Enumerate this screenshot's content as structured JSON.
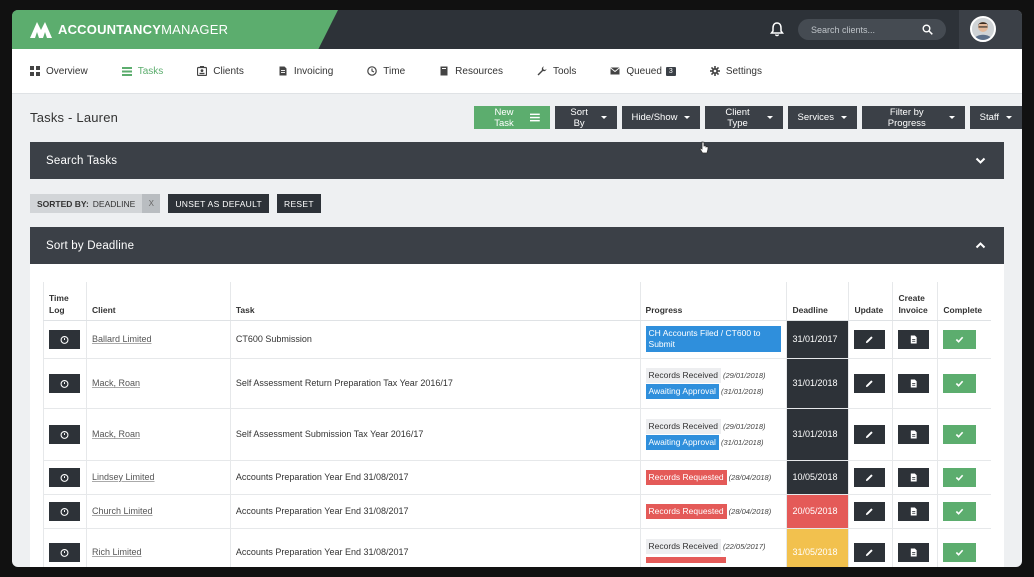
{
  "brand": {
    "name_bold": "ACCOUNTANCY",
    "name_rest": "MANAGER"
  },
  "search": {
    "placeholder": "Search clients..."
  },
  "nav": [
    {
      "label": "Overview",
      "icon": "grid-icon"
    },
    {
      "label": "Tasks",
      "icon": "list-icon",
      "active": true
    },
    {
      "label": "Clients",
      "icon": "contact-card-icon"
    },
    {
      "label": "Invoicing",
      "icon": "document-icon"
    },
    {
      "label": "Time",
      "icon": "clock-icon"
    },
    {
      "label": "Resources",
      "icon": "book-icon"
    },
    {
      "label": "Tools",
      "icon": "wrench-icon"
    },
    {
      "label": "Queued",
      "icon": "envelope-icon",
      "badge": "3"
    },
    {
      "label": "Settings",
      "icon": "gear-icon"
    }
  ],
  "page": {
    "title": "Tasks - Lauren"
  },
  "toolbar": {
    "new_task": "New Task",
    "dropdowns": [
      "Sort By",
      "Hide/Show",
      "Client Type",
      "Services",
      "Filter by Progress",
      "Staff"
    ]
  },
  "search_panel": {
    "title": "Search Tasks"
  },
  "sortbar": {
    "label": "SORTED BY:",
    "value": "DEADLINE",
    "remove": "X",
    "unset": "UNSET AS DEFAULT",
    "reset": "RESET"
  },
  "deadline_panel": {
    "title": "Sort by Deadline"
  },
  "table": {
    "headers": {
      "timelog_1": "Time",
      "timelog_2": "Log",
      "client": "Client",
      "task": "Task",
      "progress": "Progress",
      "deadline": "Deadline",
      "update": "Update",
      "invoice_1": "Create",
      "invoice_2": "Invoice",
      "complete": "Complete"
    },
    "rows": [
      {
        "client": "Ballard Limited",
        "task": "CT600 Submission",
        "progress": [
          {
            "text": "CH Accounts Filed / CT600 to Submit",
            "style": "blue",
            "date": ""
          }
        ],
        "deadline": "31/01/2017",
        "deadline_color": "#2d3238"
      },
      {
        "client": "Mack, Roan",
        "task": "Self Assessment Return Preparation Tax Year 2016/17",
        "progress": [
          {
            "text": "Records Received",
            "style": "grey",
            "date": "(29/01/2018)"
          },
          {
            "text": "Awaiting Approval",
            "style": "blue",
            "date": "(31/01/2018)"
          }
        ],
        "deadline": "31/01/2018",
        "deadline_color": "#2d3238"
      },
      {
        "client": "Mack, Roan",
        "task": "Self Assessment Submission Tax Year 2016/17",
        "progress": [
          {
            "text": "Records Received",
            "style": "grey",
            "date": "(29/01/2018)"
          },
          {
            "text": "Awaiting Approval",
            "style": "blue",
            "date": "(31/01/2018)"
          }
        ],
        "deadline": "31/01/2018",
        "deadline_color": "#2d3238"
      },
      {
        "client": "Lindsey Limited",
        "task": "Accounts Preparation Year End 31/08/2017",
        "progress": [
          {
            "text": "Records Requested",
            "style": "red",
            "date": "(28/04/2018)"
          }
        ],
        "deadline": "10/05/2018",
        "deadline_color": "#2d3238"
      },
      {
        "client": "Church Limited",
        "task": "Accounts Preparation Year End 31/08/2017",
        "progress": [
          {
            "text": "Records Requested",
            "style": "red",
            "date": "(28/04/2018)"
          }
        ],
        "deadline": "20/05/2018",
        "deadline_color": "#e45a58"
      },
      {
        "client": "Rich Limited",
        "task": "Accounts Preparation Year End 31/08/2017",
        "progress": [
          {
            "text": "Records Received",
            "style": "grey",
            "date": "(22/05/2017)"
          },
          {
            "text": "",
            "style": "red",
            "date": ""
          }
        ],
        "deadline": "31/05/2018",
        "deadline_color": "#f2c14e"
      }
    ]
  }
}
